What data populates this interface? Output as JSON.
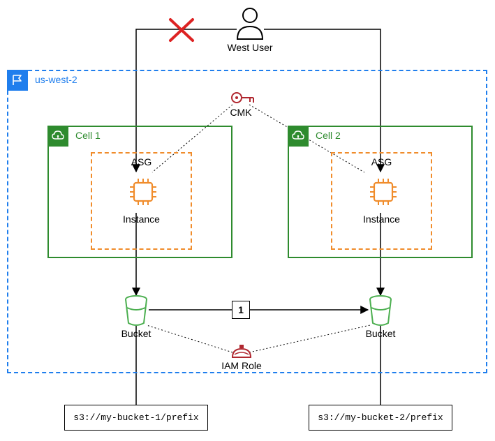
{
  "user": {
    "label": "West User"
  },
  "region": {
    "label": "us-west-2"
  },
  "cmk": {
    "label": "CMK"
  },
  "cell1": {
    "label": "Cell 1",
    "asg_label": "ASG",
    "instance_label": "Instance",
    "bucket_label": "Bucket",
    "bucket_uri": "s3://my-bucket-1/prefix"
  },
  "cell2": {
    "label": "Cell 2",
    "asg_label": "ASG",
    "instance_label": "Instance",
    "bucket_label": "Bucket",
    "bucket_uri": "s3://my-bucket-2/prefix"
  },
  "iam_role": {
    "label": "IAM Role"
  },
  "step": {
    "label": "1"
  }
}
